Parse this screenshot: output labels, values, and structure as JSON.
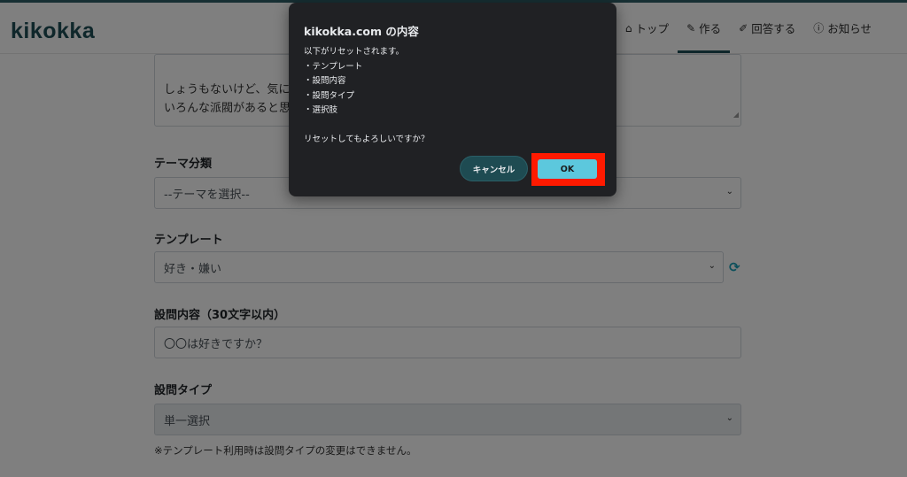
{
  "nav": {
    "logo": "kikokka",
    "items": [
      {
        "icon": "home-icon",
        "glyph": "⌂",
        "label": "トップ"
      },
      {
        "icon": "pencil-icon",
        "glyph": "✎",
        "label": "作る"
      },
      {
        "icon": "answer-icon",
        "glyph": "✐",
        "label": "回答する"
      },
      {
        "icon": "info-icon",
        "glyph": "ⓘ",
        "label": "お知らせ"
      }
    ],
    "active_item": "作る"
  },
  "form": {
    "description_value": "しょうもないけど、気になる\nいろんな派閥があると思",
    "theme_label": "テーマ分類",
    "theme_value": "--テーマを選択--",
    "template_label": "テンプレート",
    "template_value": "好き・嫌い",
    "question_label": "設問内容（30文字以内）",
    "question_value": "〇〇は好きですか？",
    "type_label": "設問タイプ",
    "type_value": "単一選択",
    "type_note": "※テンプレート利用時は設問タイプの変更はできません。"
  },
  "dialog": {
    "title": "kikokka.com の内容",
    "message_intro": "以下がリセットされます。",
    "reset_items": [
      "・テンプレート",
      "・設問内容",
      "・設問タイプ",
      "・選択肢"
    ],
    "confirm_text": "リセットしてもよろしいですか？",
    "cancel_label": "キャンセル",
    "ok_label": "OK"
  },
  "colors": {
    "brand": "#1f4e57",
    "ok_button": "#5cc8dd",
    "highlight": "#ff1a00",
    "dialog_bg": "#202124"
  }
}
